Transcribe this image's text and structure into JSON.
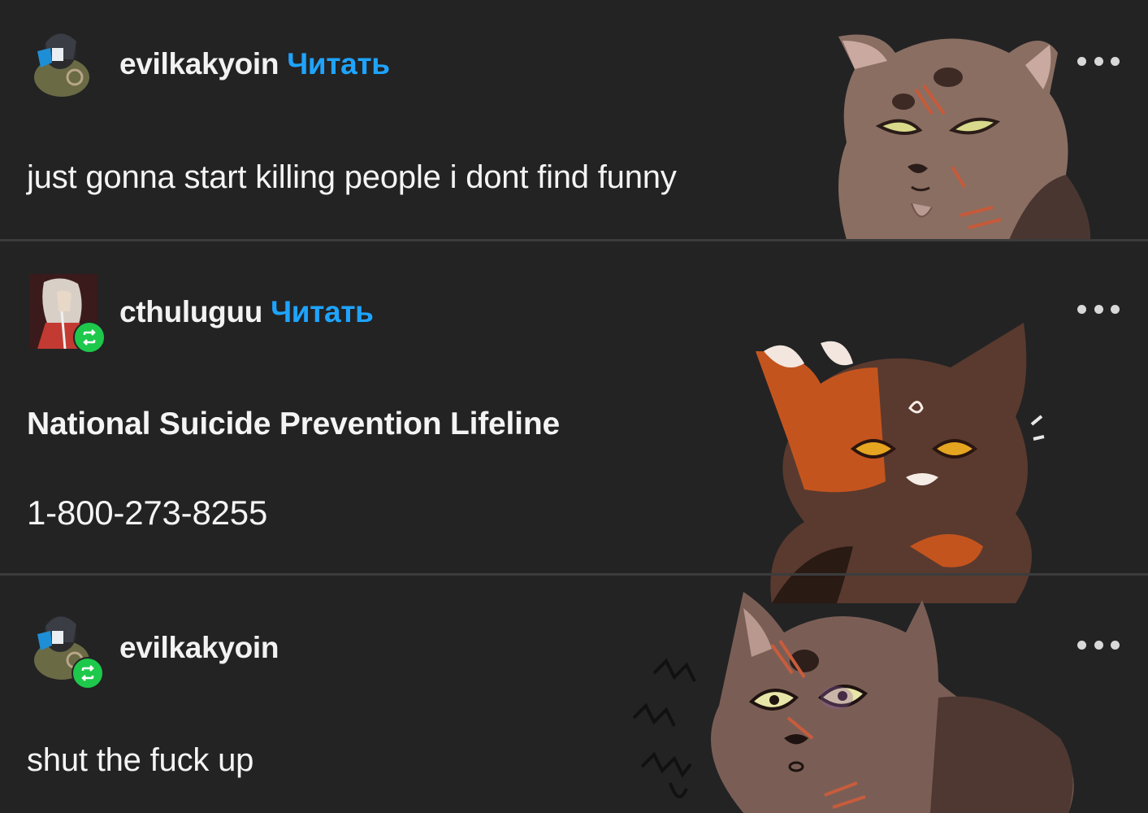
{
  "posts": [
    {
      "username": "evilkakyoin",
      "follow_label": "Читать",
      "reblogged": false,
      "text": "just gonna start killing people i dont find funny"
    },
    {
      "username": "cthuluguu",
      "follow_label": "Читать",
      "reblogged": true,
      "heading": "National Suicide Prevention Lifeline",
      "phone": "1-800-273-8255"
    },
    {
      "username": "evilkakyoin",
      "reblogged": true,
      "text": "shut the fuck up"
    }
  ],
  "colors": {
    "background": "#232324",
    "follow_link": "#1ea4ff",
    "reblog_badge": "#1ec84b",
    "divider": "#3c3c3d"
  },
  "icons": {
    "more": "more-horizontal-icon",
    "reblog": "reblog-icon"
  }
}
